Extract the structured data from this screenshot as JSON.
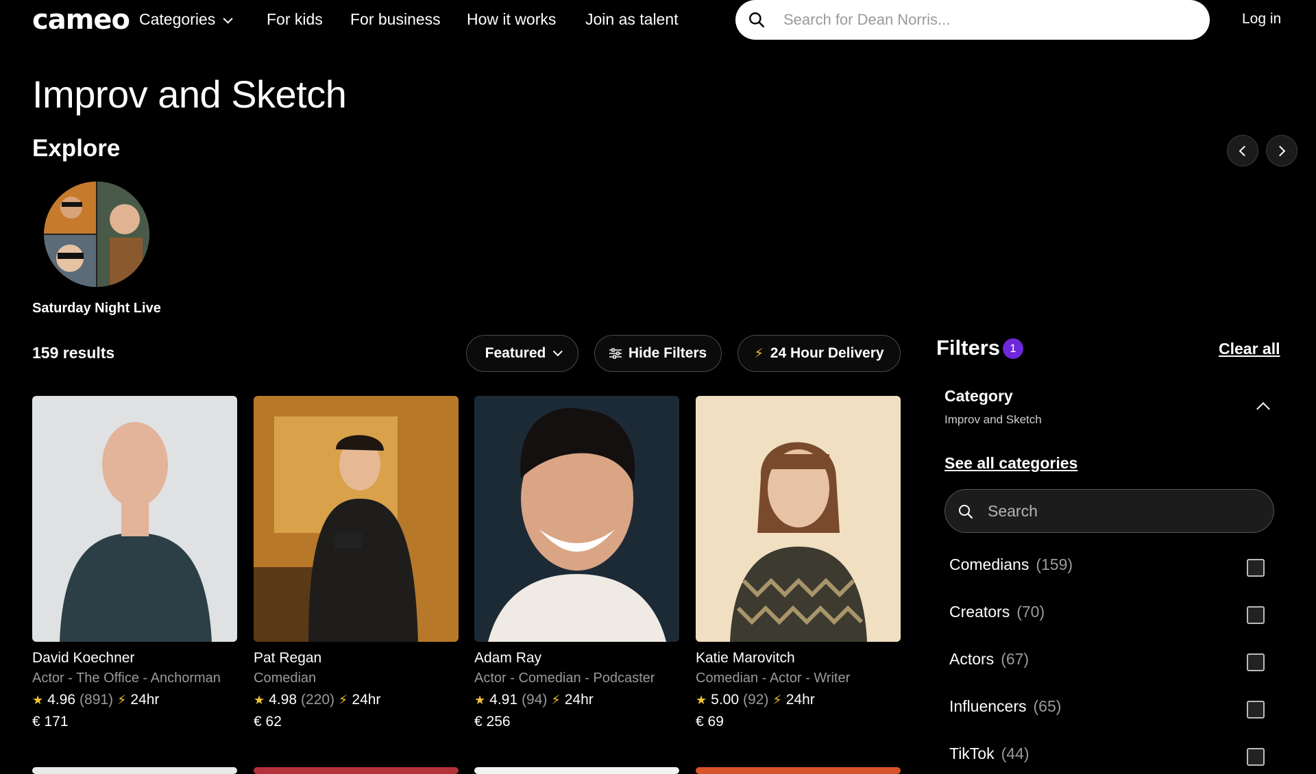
{
  "nav": {
    "logo": "cameo",
    "links": [
      "Categories",
      "For kids",
      "For business",
      "How it works",
      "Join as talent"
    ],
    "search_placeholder": "Search for Dean Norris...",
    "login": "Log in"
  },
  "page": {
    "title": "Improv and Sketch",
    "explore_title": "Explore",
    "explore_item": "Saturday Night Live",
    "results": "159 results"
  },
  "toolbar": {
    "sort": "Featured",
    "hide_filters": "Hide Filters",
    "delivery": "24 Hour Delivery"
  },
  "talent": [
    {
      "name": "David Koechner",
      "role": "Actor - The Office - Anchorman",
      "rating": "4.96",
      "reviews": "(891)",
      "delivery": "24hr",
      "price": "€ 171"
    },
    {
      "name": "Pat Regan",
      "role": "Comedian",
      "rating": "4.98",
      "reviews": "(220)",
      "delivery": "24hr",
      "price": "€ 62"
    },
    {
      "name": "Adam Ray",
      "role": "Actor - Comedian - Podcaster",
      "rating": "4.91",
      "reviews": "(94)",
      "delivery": "24hr",
      "price": "€ 256"
    },
    {
      "name": "Katie Marovitch",
      "role": "Comedian - Actor - Writer",
      "rating": "5.00",
      "reviews": "(92)",
      "delivery": "24hr",
      "price": "€ 69"
    }
  ],
  "filters": {
    "title": "Filters",
    "badge": "1",
    "clear_all": "Clear all",
    "category_label": "Category",
    "category_value": "Improv and Sketch",
    "see_all": "See all categories",
    "search_placeholder": "Search",
    "options": [
      {
        "label": "Comedians",
        "count": "(159)"
      },
      {
        "label": "Creators",
        "count": "(70)"
      },
      {
        "label": "Actors",
        "count": "(67)"
      },
      {
        "label": "Influencers",
        "count": "(65)"
      },
      {
        "label": "TikTok",
        "count": "(44)"
      }
    ]
  }
}
